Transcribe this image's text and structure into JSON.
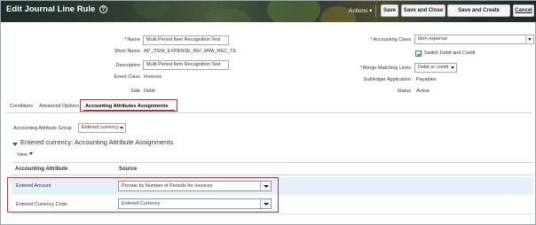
{
  "header": {
    "title": "Edit Journal Line Rule",
    "actions_label": "Actions",
    "buttons": [
      "Save",
      "Save and Close",
      "Save and Create Another",
      "Cancel"
    ]
  },
  "form": {
    "name_label": "Name",
    "name_value": "Multi Period Item Recognition Test",
    "short_name_label": "Short Name",
    "short_name_value": "AP_ITEM_EXPENSE_INV_MPA_REC_TE",
    "description_label": "Description",
    "description_value": "Multi Period Item Recognition Test",
    "event_class_label": "Event Class",
    "event_class_value": "Invoices",
    "side_label": "Side",
    "side_value": "Debit",
    "accounting_class_label": "Accounting Class",
    "accounting_class_value": "Item expense",
    "switch_label": "Switch Debit and Credit",
    "switch_checked": true,
    "merge_label": "Merge Matching Lines",
    "merge_value": "Debit or credit",
    "subledger_label": "Subledger Application",
    "subledger_value": "Payables",
    "status_label": "Status",
    "status_value": "Active"
  },
  "tabs": [
    "Conditions",
    "Advanced Options",
    "Accounting Attributes Assignments"
  ],
  "active_tab": "Accounting Attributes Assignments",
  "group": {
    "label": "Accounting Attribute Group",
    "value": "Entered currency"
  },
  "section": {
    "title": "Entered currency: Accounting Attribute Assignments",
    "view_label": "View"
  },
  "table": {
    "columns": [
      "Accounting Attribute",
      "Source"
    ],
    "rows": [
      {
        "attribute": "Entered Amount",
        "source": "Prorate by Number of Periods for Invoices"
      },
      {
        "attribute": "Entered Currency Code",
        "source": "Entered Currency"
      }
    ]
  },
  "colors": {
    "highlight": "#d92b2b",
    "selected_row": "#e6f0f8",
    "header_dark": "#2a3a33"
  }
}
